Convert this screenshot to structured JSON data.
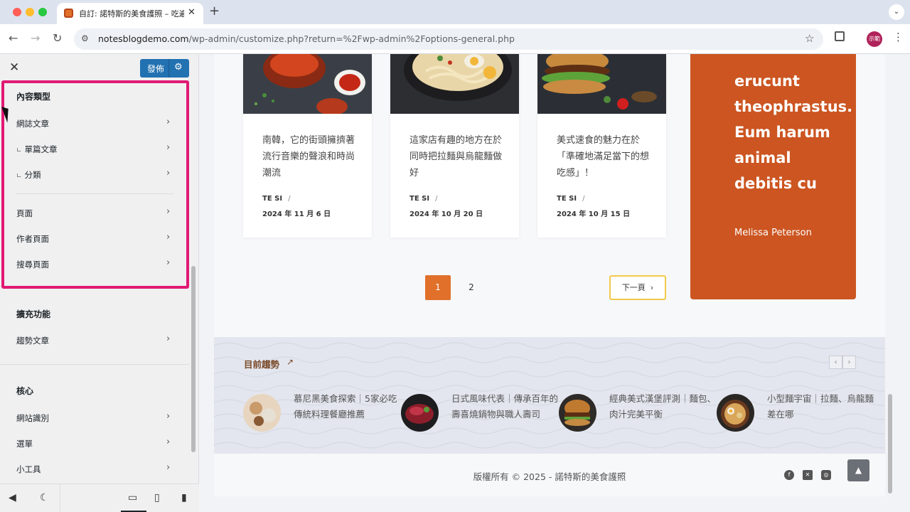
{
  "browser": {
    "tab_title": "自訂: 諾特斯的美食護照 – 吃遍",
    "url_host": "notesblogdemo.com",
    "url_path": "/wp-admin/customize.php?return=%2Fwp-admin%2Foptions-general.php",
    "profile_label": "示範"
  },
  "sidebar": {
    "publish_label": "發佈",
    "section_content_types": "內容類型",
    "items_content": [
      {
        "label": "網誌文章"
      },
      {
        "label": "單篇文章"
      },
      {
        "label": "分類"
      },
      {
        "label": "頁面"
      },
      {
        "label": "作者頁面"
      },
      {
        "label": "搜尋頁面"
      }
    ],
    "section_extensions": "擴充功能",
    "items_extensions": [
      {
        "label": "趨勢文章"
      }
    ],
    "section_core": "核心",
    "items_core": [
      {
        "label": "網站識別"
      },
      {
        "label": "選單"
      },
      {
        "label": "小工具"
      }
    ]
  },
  "preview": {
    "cards": [
      {
        "title": "南韓，它的街頭擁擠著流行音樂的聲浪和時尚潮流",
        "author": "TE SI",
        "date": "2024 年 11 月 6 日"
      },
      {
        "title": "這家店有趣的地方在於同時把拉麵與烏龍麵做好",
        "author": "TE SI",
        "date": "2024 年 10 月 20 日"
      },
      {
        "title": "美式速食的魅力在於「準確地滿足當下的想吃感」！",
        "author": "TE SI",
        "date": "2024 年 10 月 15 日"
      }
    ],
    "quote": {
      "text": "erucunt theophrastus. Eum harum animal debitis cu",
      "author": "Melissa Peterson"
    },
    "pagination": {
      "pages": [
        "1",
        "2"
      ],
      "current": "1",
      "next_label": "下一頁"
    },
    "trending": {
      "title": "目前趨勢",
      "items": [
        {
          "title": "慕尼黑美食探索｜5家必吃傳統料理餐廳推薦"
        },
        {
          "title": "日式風味代表｜傳承百年的壽喜燒鍋物與職人壽司"
        },
        {
          "title": "經典美式漢堡評測｜麵包、肉汁完美平衡"
        },
        {
          "title": "小型麵宇宙｜拉麵、烏龍麵差在哪"
        }
      ]
    },
    "footer": {
      "copyright": "版權所有 © 2025 - 諾特斯的美食護照"
    }
  },
  "colors": {
    "accent": "#e0702a",
    "quote_bg": "#cc5521",
    "publish": "#2271b1",
    "highlight": "#e11a74"
  }
}
